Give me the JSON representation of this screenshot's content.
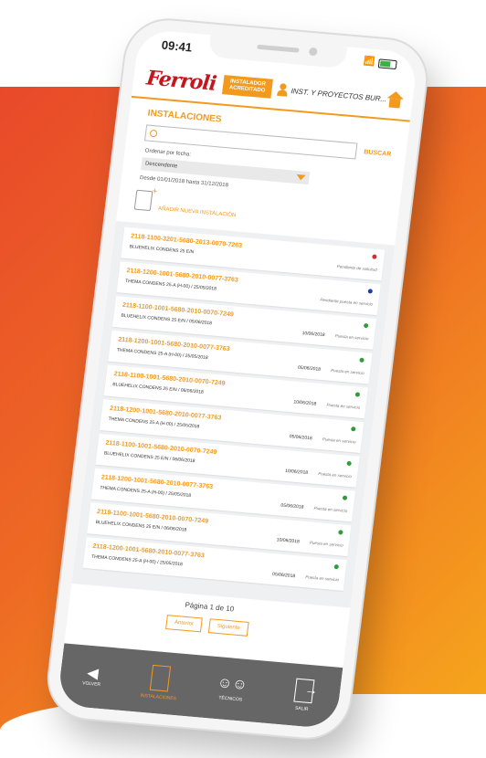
{
  "status_bar": {
    "time": "09:41",
    "battery": ""
  },
  "header": {
    "brand": "Ferroli",
    "badge_line1": "INSTALADOR",
    "badge_line2": "ACREDITADO",
    "user": "INST. Y PROYECTOS BUR..."
  },
  "instalaciones": {
    "title": "INSTALACIONES",
    "search_placeholder": "",
    "search_button": "BUSCAR",
    "sort_label": "Ordenar por fecha:",
    "sort_selected": "Descendente",
    "date_range": "Desde 01/01/2018 hasta 31/12/2018",
    "add_label": "AÑADIR NUEVA INSTALACIÓN"
  },
  "colors": {
    "accent": "#f39a1e",
    "red": "#d0312d",
    "blue": "#1f3fa8",
    "green": "#2e9d3a"
  },
  "items": [
    {
      "code": "2118-1100-3201-5680-2013-0070-7263",
      "model": "BLUEHELIX CONDENS 25 E/N",
      "date": "",
      "status": "Pendiente de solicitud",
      "dot": "red"
    },
    {
      "code": "2118-1200-1001-5680-2010-0077-3763",
      "model": "THEMA CONDENS 25-A (H-00) / 25/05/2018",
      "date": "",
      "status": "Pendiente puesta en servicio",
      "dot": "blue"
    },
    {
      "code": "2118-1100-1001-5680-2010-0070-7249",
      "model": "BLUEHELIX CONDENS 25 E/N / 05/06/2018",
      "date": "10/06/2018",
      "status": "Puesta en servicio",
      "dot": "green"
    },
    {
      "code": "2118-1200-1001-5680-2010-0077-3763",
      "model": "THEMA CONDENS 25-A (H-00) / 25/05/2018",
      "date": "05/06/2018",
      "status": "Puesta en servicio",
      "dot": "green"
    },
    {
      "code": "2118-1100-1001-5680-2010-0070-7249",
      "model": "BLUEHELIX CONDENS 25 E/N / 06/06/2018",
      "date": "10/06/2018",
      "status": "Puesta en servicio",
      "dot": "green"
    },
    {
      "code": "2118-1200-1001-5680-2010-0077-3763",
      "model": "THEMA CONDENS 25-A (H-00) / 25/05/2018",
      "date": "05/06/2018",
      "status": "Puesta en servicio",
      "dot": "green"
    },
    {
      "code": "2118-1100-1001-5680-2010-0070-7249",
      "model": "BLUEHELIX CONDENS 25 E/N / 06/06/2018",
      "date": "10/06/2018",
      "status": "Puesta en servicio",
      "dot": "green"
    },
    {
      "code": "2118-1200-1001-5680-2010-0077-3763",
      "model": "THEMA CONDENS 25-A (H-00) / 25/05/2018",
      "date": "05/06/2018",
      "status": "Puesta en servicio",
      "dot": "green"
    },
    {
      "code": "2118-1100-1001-5680-2010-0070-7249",
      "model": "BLUEHELIX CONDENS 25 E/N / 06/06/2018",
      "date": "10/06/2018",
      "status": "Puesta en servicio",
      "dot": "green"
    },
    {
      "code": "2118-1200-1001-5680-2010-0077-3763",
      "model": "THEMA CONDENS 25-A (H-00) / 25/05/2018",
      "date": "05/06/2018",
      "status": "Puesta en servicio",
      "dot": "green"
    }
  ],
  "pagination": {
    "text": "Página 1 de 10",
    "prev": "Anterior",
    "next": "Siguiente"
  },
  "bottom_nav": {
    "back": "VOLVER",
    "installations": "INSTALACIONES",
    "users": "TÉCNICOS",
    "logout": "SALIR"
  }
}
